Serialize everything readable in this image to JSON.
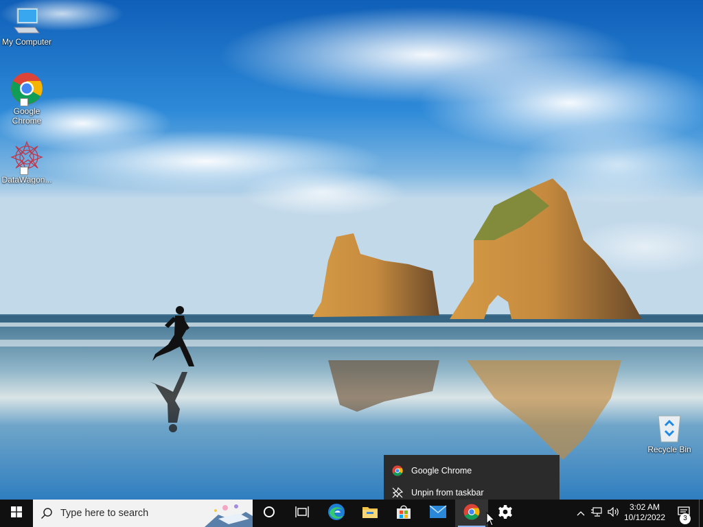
{
  "desktop": {
    "icons": [
      {
        "label": "My Computer",
        "icon": "computer-icon"
      },
      {
        "label": "Google Chrome",
        "icon": "chrome-icon"
      },
      {
        "label": "DataWagon...",
        "icon": "datawagon-icon"
      },
      {
        "label": "Recycle Bin",
        "icon": "recycle-bin-icon"
      }
    ]
  },
  "context_menu": {
    "items": [
      {
        "label": "Google Chrome",
        "icon": "chrome-icon"
      },
      {
        "label": "Unpin from taskbar",
        "icon": "unpin-icon"
      }
    ]
  },
  "taskbar": {
    "search_placeholder": "Type here to search",
    "pinned": [
      {
        "name": "cortana",
        "icon": "cortana-icon"
      },
      {
        "name": "task-view",
        "icon": "task-view-icon"
      },
      {
        "name": "edge",
        "icon": "edge-icon"
      },
      {
        "name": "file-explorer",
        "icon": "folder-icon"
      },
      {
        "name": "store",
        "icon": "store-icon"
      },
      {
        "name": "mail",
        "icon": "mail-icon"
      },
      {
        "name": "chrome",
        "icon": "chrome-icon"
      },
      {
        "name": "settings",
        "icon": "gear-icon"
      }
    ],
    "clock": {
      "time": "3:02 AM",
      "date": "10/12/2022"
    },
    "notifications": {
      "count": "3"
    }
  },
  "colors": {
    "taskbar": "#101010",
    "menu": "#2b2b2b",
    "sky": "#1d6fc2",
    "accent": "#8fb8ff"
  }
}
